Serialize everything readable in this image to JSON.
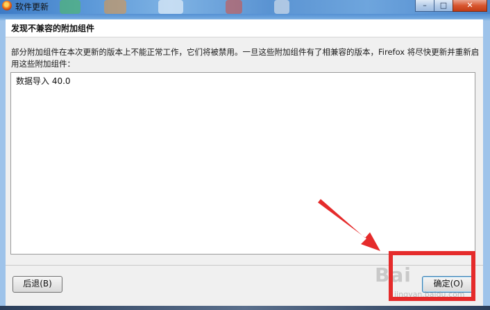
{
  "window": {
    "title": "软件更新"
  },
  "header": {
    "title": "发现不兼容的附加组件"
  },
  "main": {
    "description": "部分附加组件在本次更新的版本上不能正常工作，它们将被禁用。一旦这些附加组件有了相兼容的版本，Firefox 将尽快更新并重新启用这些附加组件：",
    "addons": [
      "数据导入 40.0"
    ]
  },
  "footer": {
    "back_label": "后退(B)",
    "ok_label": "确定(O)"
  },
  "watermark": {
    "brand": "Bai",
    "sub": "jingyan.baidu.com"
  },
  "colors": {
    "annotation": "#e52b2b",
    "titlebar": "#3d7bc6"
  },
  "icons": [
    "firefox-icon",
    "minimize-icon",
    "maximize-icon",
    "close-icon"
  ]
}
